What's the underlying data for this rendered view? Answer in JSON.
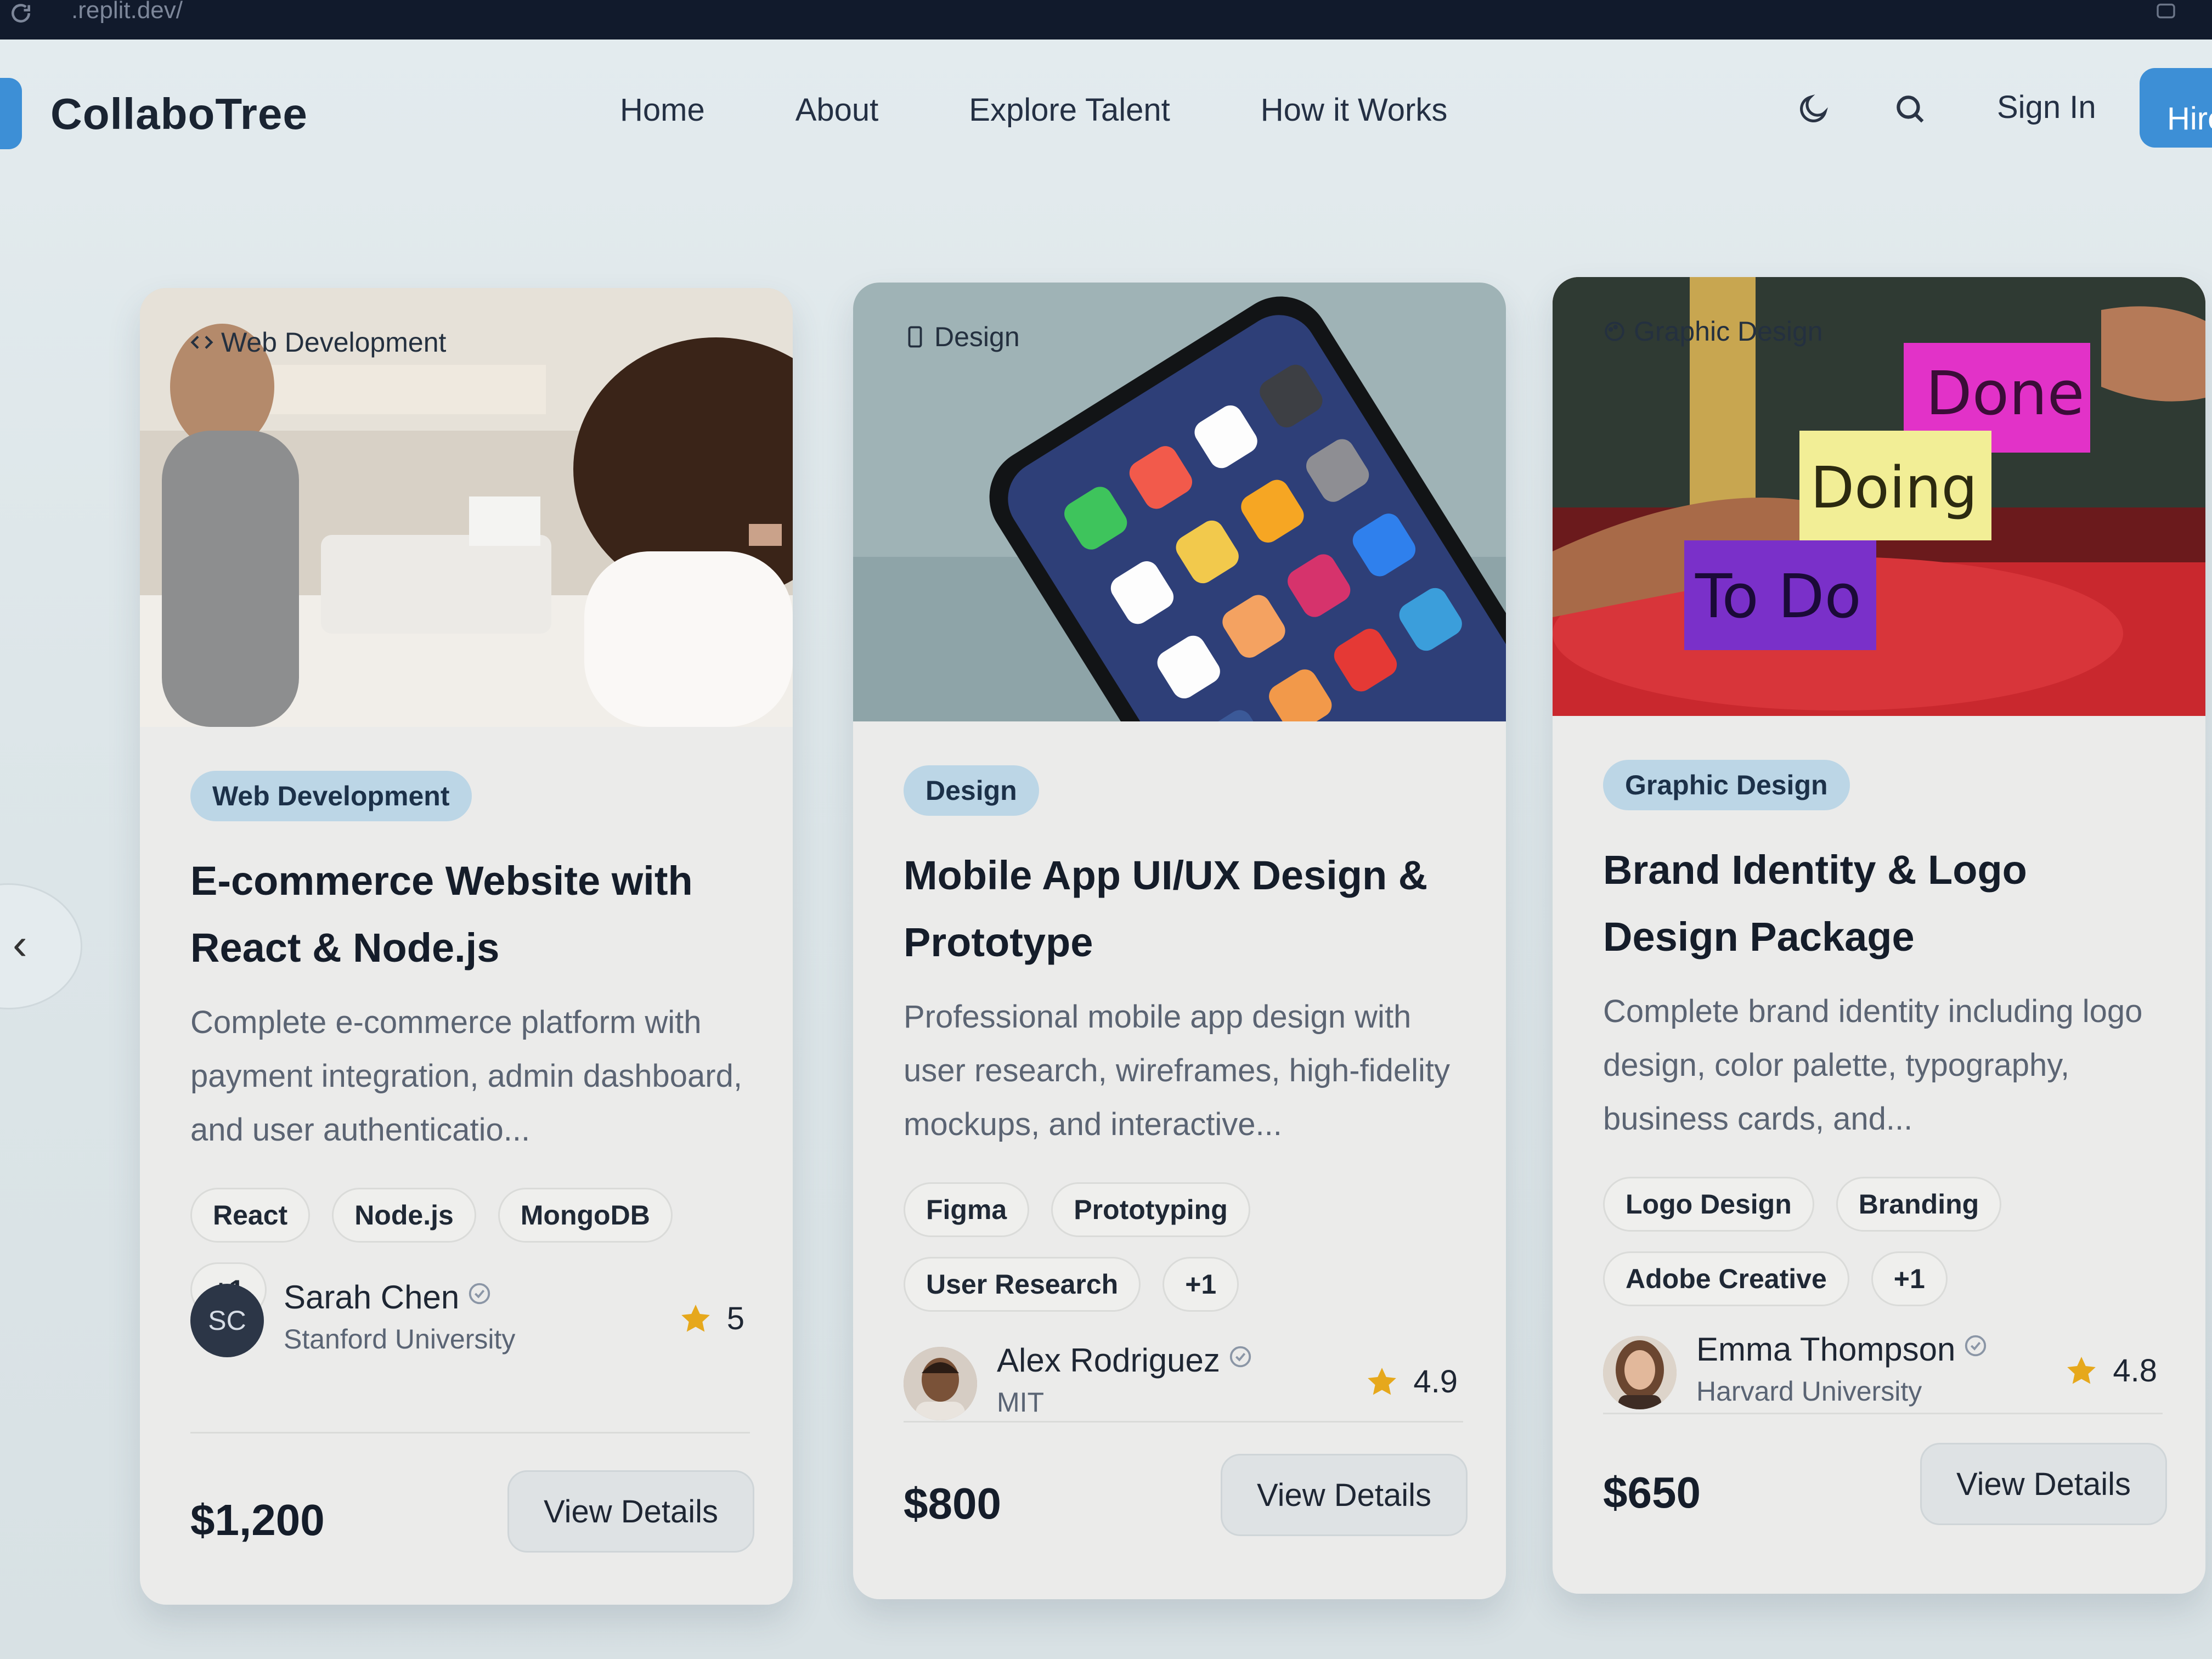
{
  "browser": {
    "url": ".replit.dev/"
  },
  "nav": {
    "logo": "CollaboTree",
    "links": [
      "Home",
      "About",
      "Explore Talent",
      "How it Works"
    ],
    "sign_in": "Sign In",
    "cta": "Hire"
  },
  "icons": {
    "theme": "moon-icon",
    "search": "search-icon",
    "carousel_prev": "chevron-left-icon",
    "verified": "check-badge-icon",
    "rating": "star-icon"
  },
  "colors": {
    "brand": "#3d8fd6",
    "pill_bg": "#bcd6e6",
    "star": "#e6a81c"
  },
  "cards": [
    {
      "image_badge": "Web Development",
      "category": "Web Development",
      "title": "E-commerce Website with React & Node.js",
      "description": "Complete e-commerce platform with payment integration, admin dashboard, and user authenticatio...",
      "tags": [
        "React",
        "Node.js",
        "MongoDB",
        "+1"
      ],
      "author": {
        "initials": "SC",
        "name": "Sarah Chen",
        "school": "Stanford University"
      },
      "rating": "5",
      "price": "$1,200",
      "cta": "View Details"
    },
    {
      "image_badge": "Design",
      "category": "Design",
      "title": "Mobile App UI/UX Design & Prototype",
      "description": "Professional mobile app design with user research, wireframes, high-fidelity mockups, and interactive...",
      "tags": [
        "Figma",
        "Prototyping",
        "User Research",
        "+1"
      ],
      "author": {
        "initials": "",
        "name": "Alex Rodriguez",
        "school": "MIT"
      },
      "rating": "4.9",
      "price": "$800",
      "cta": "View Details"
    },
    {
      "image_badge": "Graphic Design",
      "category": "Graphic Design",
      "title": "Brand Identity & Logo Design Package",
      "description": "Complete brand identity including logo design, color palette, typography, business cards, and...",
      "tags": [
        "Logo Design",
        "Branding",
        "Adobe Creative",
        "+1"
      ],
      "author": {
        "initials": "",
        "name": "Emma Thompson",
        "school": "Harvard University"
      },
      "rating": "4.8",
      "price": "$650",
      "cta": "View Details",
      "image_notes": [
        "Done",
        "Doing",
        "To Do"
      ]
    }
  ]
}
